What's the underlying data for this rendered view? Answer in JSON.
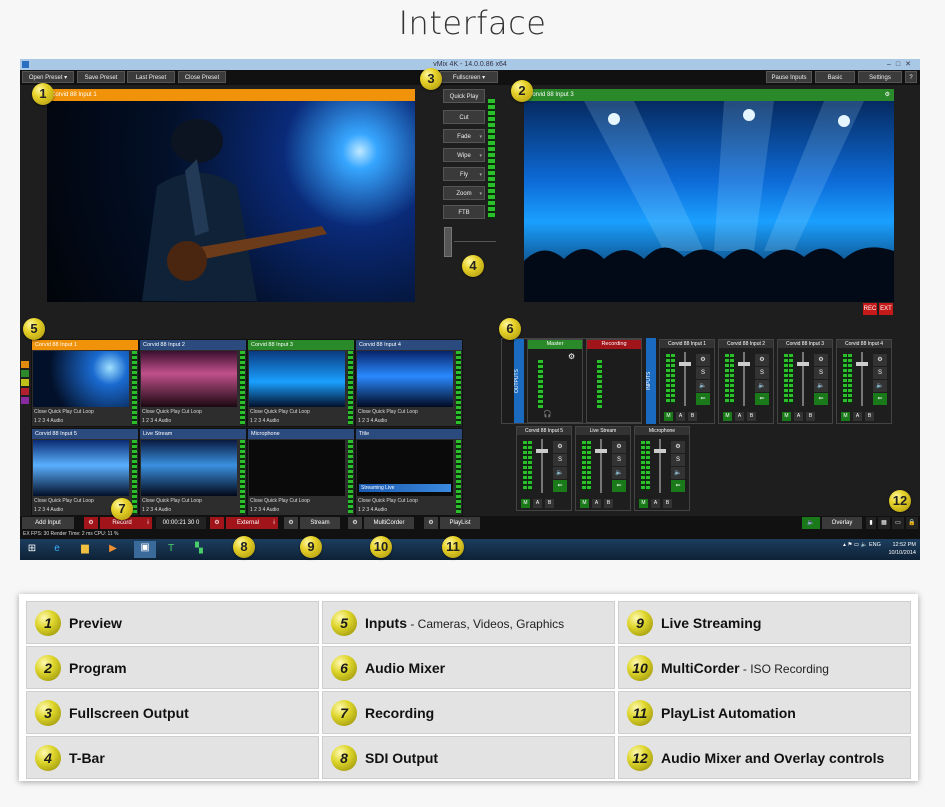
{
  "heading": "Interface",
  "app": {
    "title": "vMix 4K - 14.0.0.86 x64",
    "topbar": {
      "open_preset": "Open Preset",
      "save_preset": "Save Preset",
      "last_preset": "Last Preset",
      "close_preset": "Close Preset",
      "fullscreen": "Fullscreen",
      "pause_inputs": "Pause Inputs",
      "basic": "Basic",
      "settings": "Settings",
      "help": "?"
    },
    "preview_label": "Corvid 88 Input 1",
    "program_label": "Corvid 88 Input 3",
    "transitions": [
      "Quick Play",
      "Cut",
      "Fade",
      "Wipe",
      "Fly",
      "Zoom",
      "FTB"
    ],
    "rec": "REC",
    "ext": "EXT",
    "inputs": [
      {
        "title": "Corvid 88 Input 1",
        "controls": "Close  Quick Play  Cut  Loop",
        "row2": "1 2 3 4  Audio"
      },
      {
        "title": "Corvid 88 Input 2",
        "controls": "Close  Quick Play  Cut  Loop",
        "row2": "1 2 3 4  Audio"
      },
      {
        "title": "Corvid 88 Input 3",
        "controls": "Close  Quick Play  Cut  Loop",
        "row2": "1 2 3 4  Audio"
      },
      {
        "title": "Corvid 88 Input 4",
        "controls": "Close  Quick Play  Cut  Loop",
        "row2": "1 2 3 4  Audio"
      },
      {
        "title": "Corvid 88 Input 5",
        "controls": "Close  Quick Play  Cut  Loop",
        "row2": "1 2 3 4  Audio"
      },
      {
        "title": "Live Stream",
        "controls": "Close  Quick Play  Cut  Loop",
        "row2": "1 2 3 4  Audio"
      },
      {
        "title": "Microphone",
        "controls": "Close  Quick Play  Cut  Loop",
        "row2": "1 2 3 4  Audio"
      },
      {
        "title": "Title",
        "controls": "Close  Quick Play  Cut  Loop",
        "row2": "1 2 3 4  Audio"
      }
    ],
    "title_overlay": "Streaming Live",
    "mixer": {
      "outputs_label": "OUTPUTS",
      "inputs_label": "INPUTS",
      "master": "Master",
      "recording": "Recording",
      "channels": [
        "Corvid 88 Input 1",
        "Corvid 88 Input 2",
        "Corvid 88 Input 3",
        "Corvid 88 Input 4",
        "Corvid 88 Input 5",
        "Live Stream",
        "Microphone"
      ],
      "m": "M",
      "a": "A",
      "b": "B",
      "s": "S"
    },
    "bottombar": {
      "add_input": "Add Input",
      "record": "Record",
      "rec_time": "00:00:21 30 0",
      "external": "External",
      "stream": "Stream",
      "multicorder": "MultiCorder",
      "playlist": "PlayList",
      "overlay": "Overlay"
    },
    "status": {
      "text": "EX  FPS: 30  Render Time: 2 ms  CPU: 11 %"
    },
    "tray": {
      "lang": "ENG",
      "time": "12:52 PM",
      "date": "10/10/2014"
    }
  },
  "legend": [
    {
      "num": "1",
      "label": "Preview",
      "sub": ""
    },
    {
      "num": "5",
      "label": "Inputs",
      "sub": " - Cameras, Videos, Graphics"
    },
    {
      "num": "9",
      "label": "Live Streaming",
      "sub": ""
    },
    {
      "num": "2",
      "label": "Program",
      "sub": ""
    },
    {
      "num": "6",
      "label": "Audio Mixer",
      "sub": ""
    },
    {
      "num": "10",
      "label": "MultiCorder",
      "sub": " - ISO Recording"
    },
    {
      "num": "3",
      "label": "Fullscreen Output",
      "sub": ""
    },
    {
      "num": "7",
      "label": "Recording",
      "sub": ""
    },
    {
      "num": "11",
      "label": "PlayList Automation",
      "sub": ""
    },
    {
      "num": "4",
      "label": "T-Bar",
      "sub": ""
    },
    {
      "num": "8",
      "label": "SDI Output",
      "sub": ""
    },
    {
      "num": "12",
      "label": "Audio Mixer and Overlay controls",
      "sub": ""
    }
  ],
  "badges": [
    "1",
    "2",
    "3",
    "4",
    "5",
    "6",
    "7",
    "8",
    "9",
    "10",
    "11",
    "12"
  ]
}
